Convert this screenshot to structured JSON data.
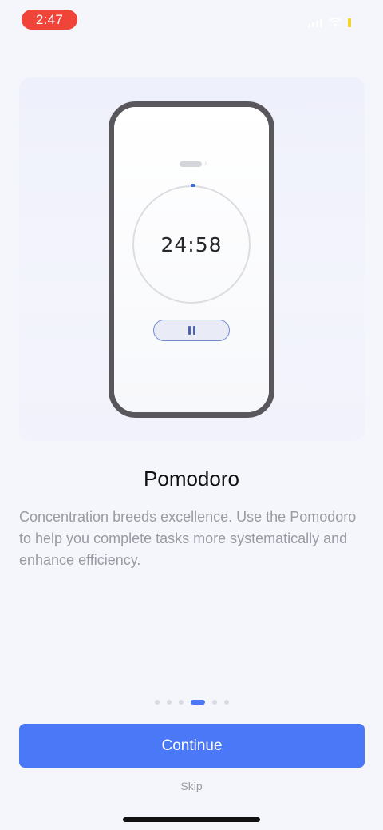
{
  "status_bar": {
    "time": "2:47",
    "icons": [
      "signal-icon",
      "wifi-icon",
      "battery-icon"
    ],
    "time_pill_color": "#f04438"
  },
  "illustration": {
    "timer": "24:58",
    "pause_icon": "pause-icon"
  },
  "onboarding": {
    "title": "Pomodoro",
    "description": "Concentration breeds excellence. Use the Pomodoro to help you complete tasks more systematically and enhance efficiency."
  },
  "pager": {
    "total": 6,
    "active_index": 3
  },
  "actions": {
    "continue_label": "Continue",
    "skip_label": "Skip"
  },
  "colors": {
    "accent": "#4a78f7",
    "background": "#f5f5fc"
  }
}
